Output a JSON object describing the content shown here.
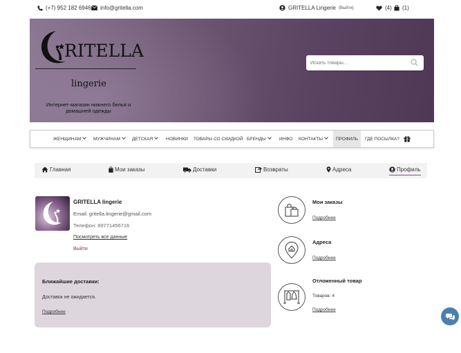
{
  "topbar": {
    "phone": "(+7) 952 182 6946",
    "email": "info@gritella.com",
    "user_name": "GRITELLA Lingerie",
    "logout_small": "(Выйти)",
    "wishlist_count": "(4)",
    "cart_count": "(1)"
  },
  "banner": {
    "logo_text": "RITELLA",
    "logo_subtitle": "lingerie",
    "logo_description": "Интернет-магазин нижнего белья и домашней одежды",
    "search_placeholder": "Искать товары..."
  },
  "nav": {
    "women": "ЖЕНЩИНАМ",
    "men": "МУЖЧИНАМ",
    "kids": "ДЕТСКАЯ",
    "new": "НОВИНКИ",
    "sale": "ТОВАРЫ СО СКИДКОЙ",
    "brands": "БРЕНДЫ",
    "info": "ИНФО",
    "contacts": "КОНТАКТЫ",
    "profile": "ПРОФИЛЬ",
    "parcel": "ГДЕ ПОСЫЛКА?"
  },
  "tabs": {
    "home": "Главная",
    "orders": "Мои заказы",
    "deliveries": "Доставки",
    "returns": "Возвраты",
    "addresses": "Адреса",
    "profile": "Профиль"
  },
  "profile": {
    "name": "GRITELLA lingerie",
    "email": "Email: gritella.lingerie@gmail.com",
    "phone": "Телефон: 89771456716",
    "view_all": "Посмотреть все данные",
    "logout": "Выйти"
  },
  "deliveries_card": {
    "title": "Ближайшие доставки:",
    "text": "Доставок не ожидается.",
    "link": "Подробнее"
  },
  "right_cards": {
    "orders_title": "Мои заказы",
    "orders_link": "Подробнее",
    "addresses_title": "Адреса",
    "addresses_link": "Подробнее",
    "saved_title": "Отложенный товар",
    "saved_count": "Товаров: 4",
    "saved_link": "Подробнее"
  },
  "colors": {
    "banner": "#6e5872",
    "accent": "#7a5a80",
    "card_bg": "#ddd6dd",
    "chat": "#4a7fb0"
  }
}
